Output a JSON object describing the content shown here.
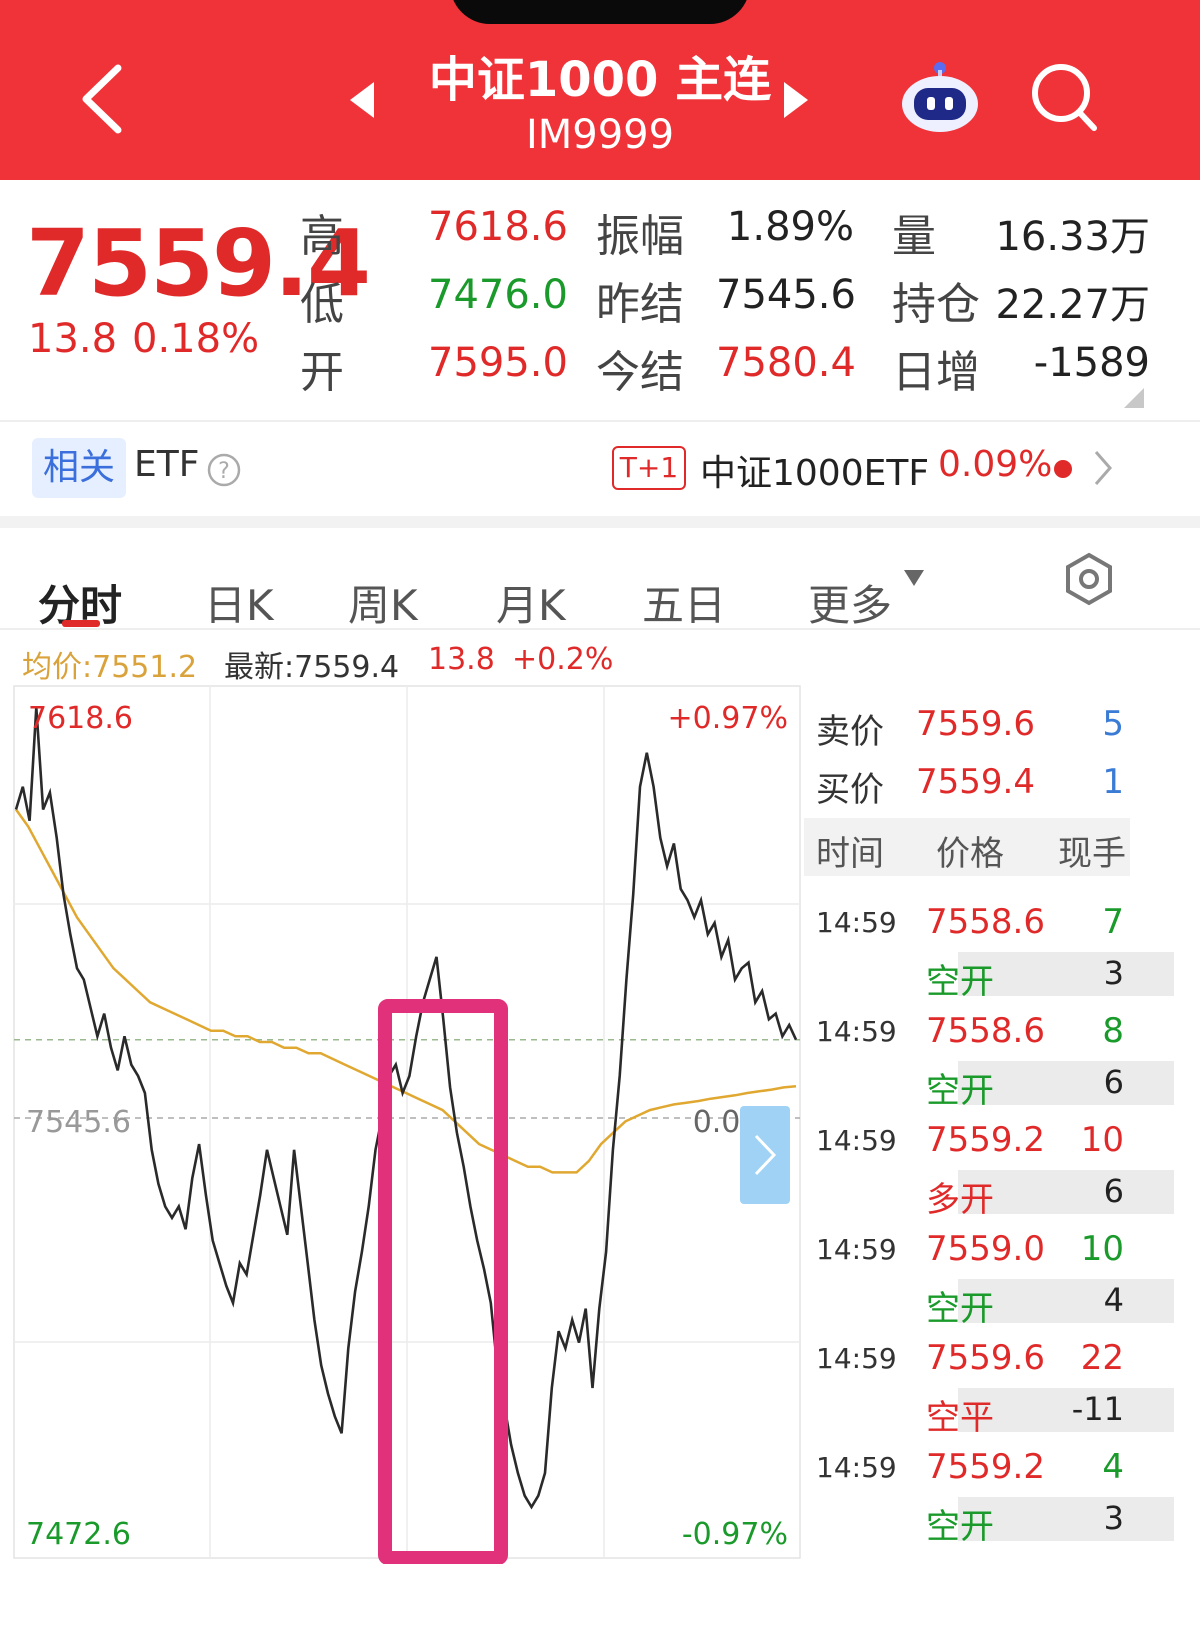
{
  "header": {
    "title": "中证1000 主连",
    "code": "IM9999",
    "back_icon": "chevron-left-icon",
    "prev_icon": "triangle-left-icon",
    "next_icon": "triangle-right-icon",
    "robot_icon": "robot-icon",
    "search_icon": "search-icon"
  },
  "quote": {
    "price": "7559.4",
    "change": "13.8",
    "change_pct": "0.18%",
    "rows": [
      {
        "l1": "高",
        "v1": "7618.6",
        "c1": "red",
        "l2": "振幅",
        "v2": "1.89%",
        "c2": "dark",
        "l3": "量",
        "v3": "16.33万"
      },
      {
        "l1": "低",
        "v1": "7476.0",
        "c1": "green",
        "l2": "昨结",
        "v2": "7545.6",
        "c2": "dark",
        "l3": "持仓",
        "v3": "22.27万"
      },
      {
        "l1": "开",
        "v1": "7595.0",
        "c1": "red",
        "l2": "今结",
        "v2": "7580.4",
        "c2": "red",
        "l3": "日增",
        "v3": "-1589"
      }
    ]
  },
  "etf": {
    "tag": "相关",
    "label": "ETF",
    "help_icon": "question-circle-icon",
    "badge": "T+1",
    "name": "中证1000ETF",
    "pct": "0.09%",
    "chevron_icon": "chevron-right-icon"
  },
  "tabs": [
    "分时",
    "日K",
    "周K",
    "月K",
    "五日",
    "更多"
  ],
  "tabs_more_icon": "caret-down-icon",
  "settings_icon": "hexagon-settings-icon",
  "info_bar": {
    "avg": "均价:7551.2",
    "latest": "最新:7559.4",
    "change": "13.8",
    "pct": "+0.2%"
  },
  "chart_data": {
    "type": "line",
    "y_max_label": "7618.6",
    "y_min_label": "7472.6",
    "y_ref_label": "7545.6",
    "pct_max_label": "+0.97%",
    "pct_min_label": "-0.97%",
    "pct_ref_label": "0.00%",
    "ylim": [
      7472.6,
      7618.6
    ],
    "reference": 7545.6,
    "series": [
      {
        "values": [
          7600,
          7604,
          7598,
          7618,
          7600,
          7603,
          7595,
          7585,
          7578,
          7572,
          7570,
          7565,
          7560,
          7564,
          7558,
          7554,
          7560,
          7555,
          7553,
          7550,
          7540,
          7534,
          7530,
          7528,
          7530,
          7526,
          7535,
          7541,
          7532,
          7524,
          7520,
          7516,
          7513,
          7520,
          7518,
          7525,
          7532,
          7540,
          7535,
          7530,
          7525,
          7540,
          7530,
          7520,
          7510,
          7502,
          7497,
          7493,
          7490,
          7505,
          7515,
          7522,
          7530,
          7540,
          7546,
          7553,
          7555,
          7550,
          7553,
          7560,
          7566,
          7570,
          7574,
          7563,
          7551,
          7543,
          7537,
          7530,
          7524,
          7519,
          7513,
          7501,
          7495,
          7488,
          7483,
          7479,
          7477,
          7479,
          7483,
          7498,
          7508,
          7505,
          7510,
          7506,
          7512,
          7498,
          7512,
          7522,
          7540,
          7553,
          7570,
          7585,
          7604,
          7610,
          7604,
          7595,
          7590,
          7594,
          7586,
          7584,
          7581,
          7584,
          7578,
          7580,
          7574,
          7577,
          7570,
          7572,
          7573,
          7566,
          7568,
          7563,
          7564,
          7560,
          7562,
          7559.4
        ]
      },
      {
        "name": "均价",
        "values": [
          7600,
          7597,
          7593,
          7589,
          7585,
          7581,
          7578,
          7575,
          7572,
          7570,
          7568,
          7566,
          7565,
          7564,
          7563,
          7562,
          7561,
          7561,
          7560,
          7560,
          7559,
          7559,
          7558,
          7558,
          7557,
          7557,
          7556,
          7555,
          7554,
          7553,
          7552,
          7551,
          7550,
          7549,
          7548,
          7547,
          7545,
          7543,
          7541,
          7540,
          7539,
          7538,
          7537,
          7537,
          7536,
          7536,
          7536,
          7538,
          7541,
          7543,
          7545,
          7546,
          7547,
          7547.5,
          7548,
          7548.3,
          7548.6,
          7549,
          7549.3,
          7549.6,
          7550,
          7550.3,
          7550.6,
          7551,
          7551.2
        ]
      }
    ]
  },
  "panel": {
    "sell_label": "卖价",
    "sell_price": "7559.6",
    "sell_qty": "5",
    "buy_label": "买价",
    "buy_price": "7559.4",
    "buy_qty": "1",
    "headers": [
      "时间",
      "价格",
      "现手"
    ],
    "ticks": [
      {
        "time": "14:59",
        "price": "7558.6",
        "price_color": "red",
        "qty": "7",
        "qty_color": "green",
        "type": "空开",
        "type_color": "green",
        "delta": "3"
      },
      {
        "time": "14:59",
        "price": "7558.6",
        "price_color": "red",
        "qty": "8",
        "qty_color": "green",
        "type": "空开",
        "type_color": "green",
        "delta": "6"
      },
      {
        "time": "14:59",
        "price": "7559.2",
        "price_color": "red",
        "qty": "10",
        "qty_color": "red",
        "type": "多开",
        "type_color": "red",
        "delta": "6"
      },
      {
        "time": "14:59",
        "price": "7559.0",
        "price_color": "red",
        "qty": "10",
        "qty_color": "green",
        "type": "空开",
        "type_color": "green",
        "delta": "4"
      },
      {
        "time": "14:59",
        "price": "7559.6",
        "price_color": "red",
        "qty": "22",
        "qty_color": "red",
        "type": "空平",
        "type_color": "red",
        "delta": "-11"
      },
      {
        "time": "14:59",
        "price": "7559.2",
        "price_color": "red",
        "qty": "4",
        "qty_color": "green",
        "type": "空开",
        "type_color": "green",
        "delta": "3"
      }
    ]
  }
}
